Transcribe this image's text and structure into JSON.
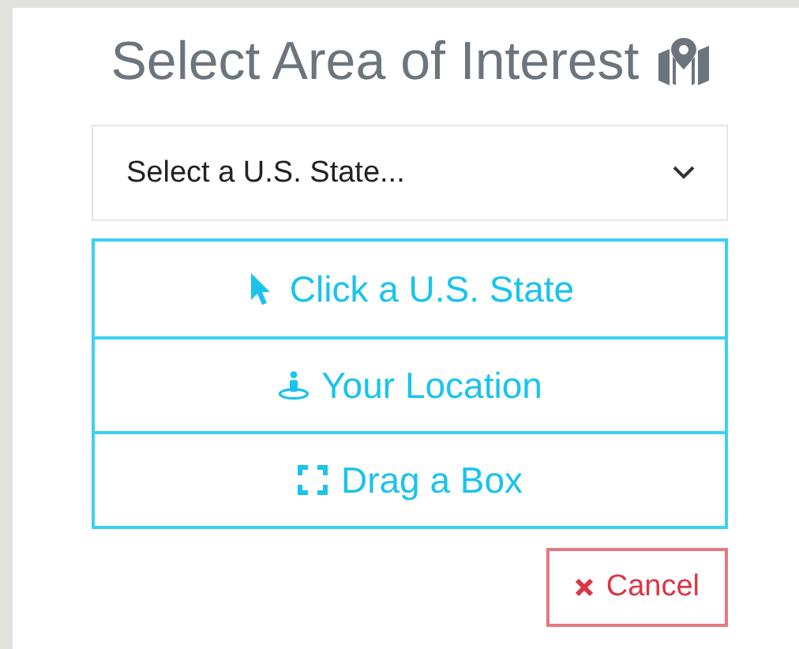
{
  "title": "Select Area of Interest",
  "state_select": {
    "placeholder": "Select a U.S. State..."
  },
  "methods": [
    {
      "kind": "click",
      "label": "Click a U.S. State"
    },
    {
      "kind": "location",
      "label": "Your Location"
    },
    {
      "kind": "drag",
      "label": "Drag a Box"
    }
  ],
  "cancel_button": {
    "label": "Cancel"
  }
}
